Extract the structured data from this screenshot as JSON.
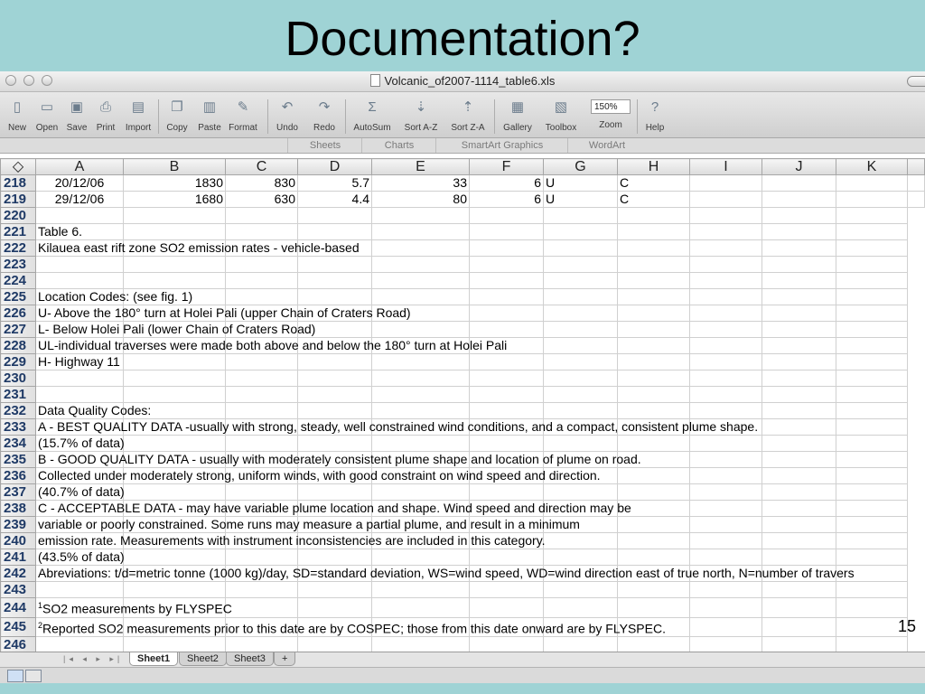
{
  "slide": {
    "title": "Documentation?",
    "page_number": "15"
  },
  "window": {
    "title": "Volcanic_of2007-1114_table6.xls"
  },
  "toolbar": {
    "buttons": [
      {
        "label": "New",
        "icon": "new-icon",
        "glyph": "▯"
      },
      {
        "label": "Open",
        "icon": "open-icon",
        "glyph": "▭"
      },
      {
        "label": "Save",
        "icon": "save-icon",
        "glyph": "▣"
      },
      {
        "label": "Print",
        "icon": "print-icon",
        "glyph": "⎙"
      },
      {
        "label": "Import",
        "icon": "import-icon",
        "glyph": "▤"
      },
      {
        "label": "Copy",
        "icon": "copy-icon",
        "glyph": "❐"
      },
      {
        "label": "Paste",
        "icon": "paste-icon",
        "glyph": "▥"
      },
      {
        "label": "Format",
        "icon": "format-brush-icon",
        "glyph": "✎"
      },
      {
        "label": "Undo",
        "icon": "undo-icon",
        "glyph": "↶"
      },
      {
        "label": "Redo",
        "icon": "redo-icon",
        "glyph": "↷"
      },
      {
        "label": "AutoSum",
        "icon": "autosum-icon",
        "glyph": "Σ"
      },
      {
        "label": "Sort A-Z",
        "icon": "sort-az-icon",
        "glyph": "⇣"
      },
      {
        "label": "Sort Z-A",
        "icon": "sort-za-icon",
        "glyph": "⇡"
      },
      {
        "label": "Gallery",
        "icon": "gallery-icon",
        "glyph": "▦"
      },
      {
        "label": "Toolbox",
        "icon": "toolbox-icon",
        "glyph": "▧"
      },
      {
        "label": "Zoom",
        "icon": "zoom-field",
        "glyph": ""
      },
      {
        "label": "Help",
        "icon": "help-icon",
        "glyph": "?"
      }
    ],
    "zoom_value": "150%"
  },
  "ribbon_tabs": [
    "Sheets",
    "Charts",
    "SmartArt Graphics",
    "WordArt"
  ],
  "columns": [
    "A",
    "B",
    "C",
    "D",
    "E",
    "F",
    "G",
    "H",
    "I",
    "J",
    "K"
  ],
  "rows": [
    {
      "n": "218",
      "cells": [
        "20/12/06",
        "1830",
        "830",
        "5.7",
        "33",
        "6",
        "U",
        "C",
        "",
        "",
        ""
      ]
    },
    {
      "n": "219",
      "cells": [
        "29/12/06",
        "1680",
        "630",
        "4.4",
        "80",
        "6",
        "U",
        "C",
        "",
        "",
        ""
      ]
    },
    {
      "n": "220",
      "text": ""
    },
    {
      "n": "221",
      "text": "Table 6."
    },
    {
      "n": "222",
      "text": "Kilauea east rift zone SO2 emission rates - vehicle-based"
    },
    {
      "n": "223",
      "text": ""
    },
    {
      "n": "224",
      "text": ""
    },
    {
      "n": "225",
      "text": "Location Codes: (see fig. 1)"
    },
    {
      "n": "226",
      "text": "U- Above the 180° turn at Holei Pali (upper Chain of Craters Road)"
    },
    {
      "n": "227",
      "text": "L- Below Holei Pali (lower Chain of Craters Road)"
    },
    {
      "n": "228",
      "text": "UL-individual traverses were made both above and below the 180° turn at Holei Pali"
    },
    {
      "n": "229",
      "text": "H- Highway 11"
    },
    {
      "n": "230",
      "text": ""
    },
    {
      "n": "231",
      "text": ""
    },
    {
      "n": "232",
      "text": "Data Quality Codes:"
    },
    {
      "n": "233",
      "text": "A - BEST QUALITY DATA -usually with strong, steady, well constrained wind conditions, and a compact, consistent plume shape."
    },
    {
      "n": "234",
      "text": "(15.7% of data)"
    },
    {
      "n": "235",
      "text": "B - GOOD QUALITY DATA - usually with moderately consistent plume shape and location of plume on road."
    },
    {
      "n": "236",
      "text": "Collected under moderately strong, uniform winds, with good constraint on wind speed and direction."
    },
    {
      "n": "237",
      "text": "(40.7% of data)"
    },
    {
      "n": "238",
      "text": "C - ACCEPTABLE DATA - may have variable plume location and shape. Wind speed and direction may be"
    },
    {
      "n": "239",
      "text": "variable or poorly constrained. Some runs may measure a partial plume, and result in a minimum"
    },
    {
      "n": "240",
      "text": "emission rate. Measurements with instrument inconsistencies are included in this category."
    },
    {
      "n": "241",
      "text": "(43.5% of data)"
    },
    {
      "n": "242",
      "text": "Abreviations: t/d=metric tonne (1000 kg)/day, SD=standard deviation, WS=wind speed, WD=wind direction east of true north, N=number of travers"
    },
    {
      "n": "243",
      "text": ""
    },
    {
      "n": "244",
      "text": "SO2 measurements by FLYSPEC",
      "sup": "1"
    },
    {
      "n": "245",
      "text": "Reported SO2 measurements prior to this date are by COSPEC; those from this date onward are by FLYSPEC.",
      "sup": "2"
    },
    {
      "n": "246",
      "text": ""
    }
  ],
  "sheet_tabs": [
    "Sheet1",
    "Sheet2",
    "Sheet3",
    "+"
  ],
  "sheet_nav": "|◂ ◂ ▸ ▸|",
  "colors": {
    "background": "#9fd3d5",
    "row_header_text": "#1f3a66"
  }
}
